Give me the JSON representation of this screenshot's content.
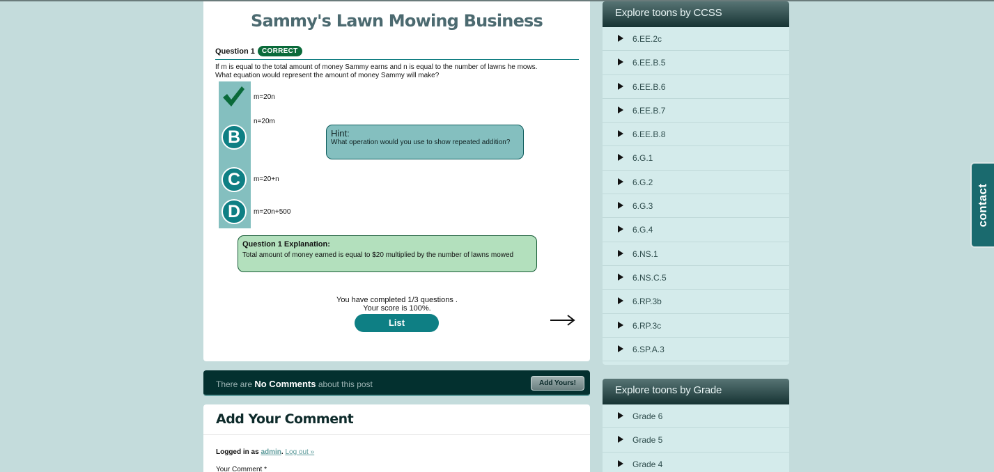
{
  "quiz": {
    "title": "Sammy's Lawn Mowing Business",
    "question_label": "Question 1",
    "status_badge": "CORRECT",
    "question_text": "If m is equal to the total amount of money Sammy earns and n is equal to the number of lawns he mows. What equation would represent the amount of money Sammy will make?",
    "choices": [
      {
        "letter": "",
        "text": "m=20n",
        "state": "correct"
      },
      {
        "letter": "B",
        "text": "n=20m"
      },
      {
        "letter": "C",
        "text": "m=20+n"
      },
      {
        "letter": "D",
        "text": "m=20n+500"
      }
    ],
    "hint": {
      "title": "Hint:",
      "text": "What operation would you use to show repeated addition?"
    },
    "explanation": {
      "title": "Question 1 Explanation:",
      "text": "Total amount of money earned is equal to $20 multiplied by the number of lawns mowed"
    },
    "progress_line": "You have completed 1/3 questions .",
    "score_line": "Your score is 100%.",
    "list_button": "List",
    "next_icon": "arrow-right-icon"
  },
  "comments_bar": {
    "prefix": "There are ",
    "highlight": "No Comments",
    "suffix": " about this post",
    "add_button": "Add Yours!"
  },
  "comment_form": {
    "title": "Add Your Comment",
    "logged_prefix": "Logged in as ",
    "user": "admin",
    "period": ".",
    "logout": "Log out »",
    "comment_label": "Your Comment *"
  },
  "sidebar": {
    "ccss": {
      "title": "Explore toons by CCSS",
      "items": [
        "6.EE.2c",
        "6.EE.B.5",
        "6.EE.B.6",
        "6.EE.B.7",
        "6.EE.B.8",
        "6.G.1",
        "6.G.2",
        "6.G.3",
        "6.G.4",
        "6.NS.1",
        "6.NS.C.5",
        "6.RP.3b",
        "6.RP.3c",
        "6.SP.A.3"
      ]
    },
    "grade": {
      "title": "Explore toons by Grade",
      "items": [
        "Grade 6",
        "Grade 5",
        "Grade 4"
      ]
    }
  },
  "contact_tab": "contact",
  "colors": {
    "page_bg": "#c4dcdc",
    "teal": "#0e7f84",
    "correct_green": "#0a6a3a",
    "sidebar_bg": "#d4ebeb"
  }
}
